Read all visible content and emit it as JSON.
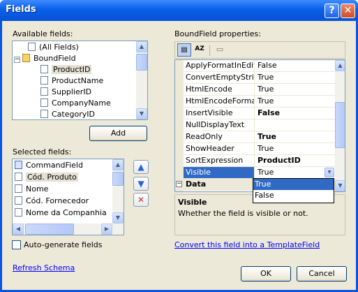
{
  "window": {
    "title": "Fields"
  },
  "available_fields": {
    "label": "Available fields:",
    "items": [
      "(All Fields)",
      "BoundField",
      "ProductID",
      "ProductName",
      "SupplierID",
      "CompanyName",
      "CategoryID"
    ]
  },
  "add_button": "Add",
  "selected_fields": {
    "label": "Selected fields:",
    "items": [
      "CommandField",
      "Cód. Produto",
      "Nome",
      "Cód. Fornecedor",
      "Nome da Companhia"
    ]
  },
  "auto_generate": {
    "label": "Auto-generate fields",
    "checked": false
  },
  "refresh_schema": "Refresh Schema",
  "properties": {
    "label": "BoundField properties:",
    "rows": [
      {
        "name": "ApplyFormatInEditM",
        "value": "False",
        "bold": false
      },
      {
        "name": "ConvertEmptyString",
        "value": "True",
        "bold": false
      },
      {
        "name": "HtmlEncode",
        "value": "True",
        "bold": false
      },
      {
        "name": "HtmlEncodeFormatS",
        "value": "True",
        "bold": false
      },
      {
        "name": "InsertVisible",
        "value": "False",
        "bold": true
      },
      {
        "name": "NullDisplayText",
        "value": "",
        "bold": false
      },
      {
        "name": "ReadOnly",
        "value": "True",
        "bold": true
      },
      {
        "name": "ShowHeader",
        "value": "True",
        "bold": false
      },
      {
        "name": "SortExpression",
        "value": "ProductID",
        "bold": true
      },
      {
        "name": "Visible",
        "value": "True",
        "bold": false,
        "selected": true
      }
    ],
    "category": "Data",
    "dropdown_options": [
      "True",
      "False"
    ],
    "dropdown_selected": "True"
  },
  "description": {
    "title": "Visible",
    "text": "Whether the field is visible or not."
  },
  "convert_link": "Convert this field into a TemplateField",
  "ok_button": "OK",
  "cancel_button": "Cancel",
  "colors": {
    "title_bar": "#0a54e0",
    "dialog": "#ece9d8",
    "selection": "#316ac5"
  }
}
